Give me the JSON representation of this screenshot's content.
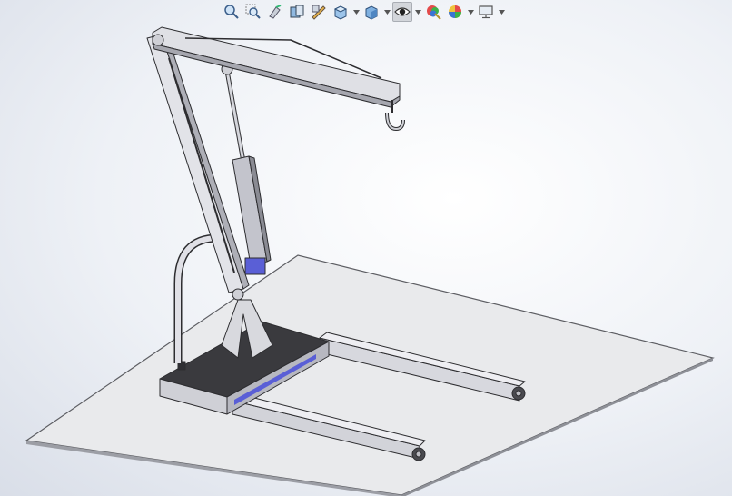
{
  "app": {
    "type": "cad-viewport",
    "scene": "engine-crane-assembly"
  },
  "toolbar": {
    "items": [
      {
        "icon": "zoom-to-fit-icon"
      },
      {
        "icon": "zoom-to-area-icon"
      },
      {
        "icon": "previous-view-icon"
      },
      {
        "icon": "section-view-icon"
      },
      {
        "icon": "dynamic-annotation-views-icon"
      },
      {
        "icon": "view-orientation-icon",
        "has_dropdown": true
      },
      {
        "icon": "display-style-icon",
        "has_dropdown": true
      },
      {
        "icon": "hide-show-items-icon",
        "has_dropdown": true,
        "active": true
      },
      {
        "icon": "edit-appearance-icon"
      },
      {
        "icon": "apply-scene-icon",
        "has_dropdown": true
      },
      {
        "icon": "view-settings-icon",
        "has_dropdown": true
      }
    ]
  },
  "colors": {
    "viewport_center": "#ffffff",
    "viewport_edge": "#d9dee8",
    "floor_plane": "#e9eaec",
    "part_light": "#d8d8de",
    "part_mid": "#bfc0c8",
    "part_dark": "#6b6c72",
    "base_top": "#3c3c40",
    "highlight_blue": "#5a5fd6"
  }
}
